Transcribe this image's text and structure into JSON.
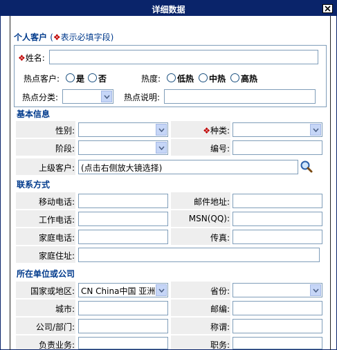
{
  "window": {
    "title": "详细数据"
  },
  "personal": {
    "heading": "个人客户",
    "note_open": "(",
    "note_star": "❖",
    "note_text": "表示必填字段)",
    "name_star": "❖",
    "name_label": "姓名:",
    "name_value": "",
    "hot_customer_label": "热点客户:",
    "hot_yes": "是",
    "hot_no": "否",
    "heat_label": "热度:",
    "heat_low": "低热",
    "heat_mid": "中热",
    "heat_high": "高热",
    "hot_category_label": "热点分类:",
    "hot_category_value": "",
    "hot_desc_label": "热点说明:",
    "hot_desc_value": ""
  },
  "basic": {
    "heading": "基本信息",
    "gender_label": "性别:",
    "gender_value": "",
    "kind_star": "❖",
    "kind_label": "种类:",
    "kind_value": "",
    "stage_label": "阶段:",
    "stage_value": "",
    "number_label": "编号:",
    "number_value": "",
    "parent_label": "上级客户:",
    "parent_value": "(点击右侧放大镜选择)"
  },
  "contact": {
    "heading": "联系方式",
    "mobile_label": "移动电话:",
    "email_label": "邮件地址:",
    "work_phone_label": "工作电话:",
    "msn_label": "MSN(QQ):",
    "home_phone_label": "家庭电话:",
    "fax_label": "传真:",
    "home_addr_label": "家庭住址:"
  },
  "company": {
    "heading": "所在单位或公司",
    "country_label": "国家或地区:",
    "country_value": "CN China中国 亚洲",
    "province_label": "省份:",
    "province_value": "",
    "city_label": "城市:",
    "zip_label": "邮编:",
    "dept_label": "公司/部门:",
    "title_label": "称谓:",
    "business_label": "负责业务:",
    "position_label": "职务:"
  },
  "icons": {
    "close": "close-icon",
    "magnifier": "magnifier-icon",
    "dropdown": "chevron-down-icon"
  },
  "colors": {
    "titlebar": "#0a246a",
    "heading": "#003a8c",
    "required": "#c00000",
    "label_bg": "#eeeeee",
    "border": "#7f9db9"
  }
}
